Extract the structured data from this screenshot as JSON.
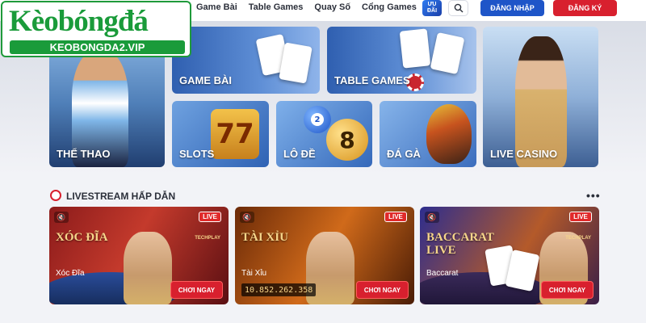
{
  "header": {
    "nav": [
      "Game Bài",
      "Table Games",
      "Quay Số",
      "Cổng Games"
    ],
    "uu_badge": "ƯU ĐÃI",
    "login_label": "ĐĂNG NHẬP",
    "register_label": "ĐĂNG KÝ"
  },
  "logo": {
    "name": "Kèobóngđá",
    "domain": "KEOBONGDA2.VIP"
  },
  "tiles": {
    "thethao": "THỂ THAO",
    "gamebai": "GAME BÀI",
    "tablegames": "TABLE GAMES",
    "livecasino": "LIVE CASINO",
    "slots": "SLOTS",
    "lode": "LÔ ĐỀ",
    "daga": "ĐÁ GÀ"
  },
  "livestream": {
    "title": "LIVESTREAM HẤP DẪN",
    "more": "•••",
    "cards": [
      {
        "title": "XÓC ĐĨA",
        "name": "Xóc Đĩa",
        "badge": "LIVE",
        "provider": "TECHPLAY",
        "button": "CHƠI NGAY"
      },
      {
        "title": "TÀI XỈU",
        "name": "Tài Xỉu",
        "badge": "LIVE",
        "jackpot": "10.852.262.358",
        "button": "CHƠI NGAY"
      },
      {
        "title": "BACCARAT LIVE",
        "name": "Baccarat",
        "badge": "LIVE",
        "provider": "TECHPLAY",
        "button": "CHƠI NGAY"
      }
    ]
  },
  "colors": {
    "brand_green": "#1a9b3a",
    "login_blue": "#1e55c8",
    "register_red": "#d8202e"
  }
}
